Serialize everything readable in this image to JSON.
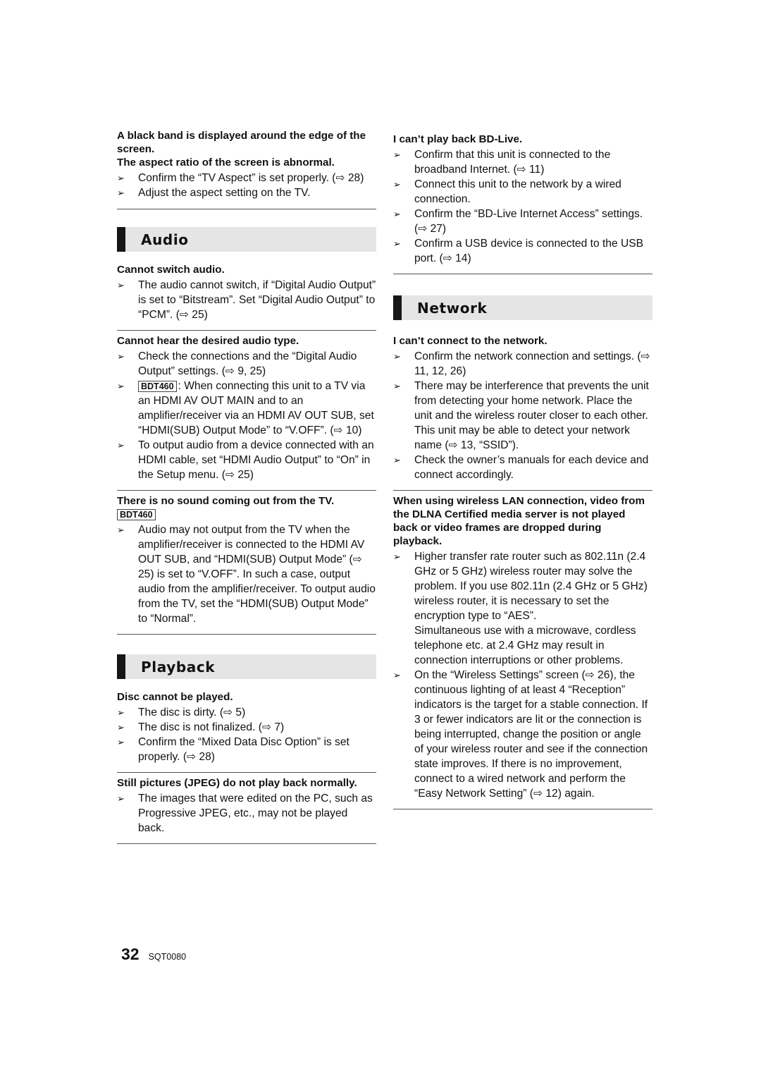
{
  "left_column": {
    "block1": {
      "question_lines": [
        "A black band is displayed around the edge of the screen.",
        "The aspect ratio of the screen is abnormal."
      ],
      "items": [
        "Confirm the “TV Aspect” is set properly. (⇨ 28)",
        "Adjust the aspect setting on the TV."
      ]
    },
    "audio": {
      "title": "Audio",
      "q1": {
        "question": "Cannot switch audio.",
        "items": [
          "The audio cannot switch, if “Digital Audio Output” is set to “Bitstream”. Set “Digital Audio Output” to “PCM”. (⇨ 25)"
        ]
      },
      "q2": {
        "question": "Cannot hear the desired audio type.",
        "items": [
          "Check the connections and the “Digital Audio Output” settings. (⇨ 9, 25)",
          ": When connecting this unit to a TV via an HDMI AV OUT MAIN and to an amplifier/receiver via an HDMI AV OUT SUB, set “HDMI(SUB) Output Mode” to “V.OFF”. (⇨ 10)",
          "To output audio from a device connected with an HDMI cable, set “HDMI Audio Output” to “On” in the Setup menu. (⇨ 25)"
        ],
        "badge": "BDT460"
      },
      "q3": {
        "question": "There is no sound coming out from the TV.",
        "badge": "BDT460",
        "items": [
          "Audio may not output from the TV when the amplifier/receiver is connected to the HDMI AV OUT SUB, and “HDMI(SUB) Output Mode” (⇨ 25) is set to “V.OFF”. In such a case, output audio from the amplifier/receiver. To output audio from the TV, set the “HDMI(SUB) Output Mode” to “Normal”."
        ]
      }
    },
    "playback": {
      "title": "Playback",
      "q1": {
        "question": "Disc cannot be played.",
        "items": [
          "The disc is dirty. (⇨ 5)",
          "The disc is not finalized. (⇨ 7)",
          "Confirm the “Mixed Data Disc Option” is set properly. (⇨ 28)"
        ]
      },
      "q2": {
        "question": "Still pictures (JPEG) do not play back normally.",
        "items": [
          "The images that were edited on the PC, such as Progressive JPEG, etc., may not be played back."
        ]
      }
    }
  },
  "right_column": {
    "bdlive": {
      "question": "I can’t play back BD-Live.",
      "items": [
        "Confirm that this unit is connected to the broadband Internet. (⇨ 11)",
        "Connect this unit to the network by a wired connection.",
        "Confirm the “BD-Live Internet Access” settings. (⇨ 27)",
        "Confirm a USB device is connected to the USB port. (⇨ 14)"
      ]
    },
    "network": {
      "title": "Network",
      "q1": {
        "question": "I can’t connect to the network.",
        "items": [
          "Confirm the network connection and settings. (⇨ 11, 12, 26)",
          "There may be interference that prevents the unit from detecting your home network. Place the unit and the wireless router closer to each other. This unit may be able to detect your network name (⇨ 13, “SSID”).",
          "Check the owner’s manuals for each device and connect accordingly."
        ]
      },
      "q2": {
        "question": "When using wireless LAN connection, video from the DLNA Certified media server is not played back or video frames are dropped during playback.",
        "items": [
          "Higher transfer rate router such as 802.11n (2.4 GHz or 5 GHz) wireless router may solve the problem. If you use 802.11n (2.4 GHz or 5 GHz) wireless router, it is necessary to set the encryption type to “AES”.",
          "On the “Wireless Settings” screen (⇨ 26), the continuous lighting of at least 4 “Reception” indicators is the target for a stable connection. If 3 or fewer indicators are lit or the connection is being interrupted, change the position or angle of your wireless router and see if the connection state improves. If there is no improvement, connect to a wired network and perform the “Easy Network Setting” (⇨ 12) again."
        ],
        "item1_extra": "Simultaneous use with a microwave, cordless telephone etc. at 2.4 GHz may result in connection interruptions or other problems."
      }
    }
  },
  "footer": {
    "page_number": "32",
    "doc_code": "SQT0080"
  },
  "bullet_glyph": "➢"
}
